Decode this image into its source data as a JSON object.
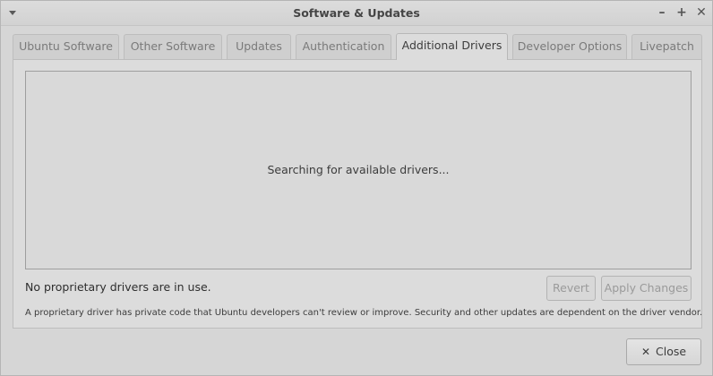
{
  "window": {
    "title": "Software & Updates",
    "controls": {
      "minimize": "–",
      "maximize": "+",
      "close": "✕"
    }
  },
  "tabs": [
    {
      "label": "Ubuntu Software",
      "active": false
    },
    {
      "label": "Other Software",
      "active": false
    },
    {
      "label": "Updates",
      "active": false
    },
    {
      "label": "Authentication",
      "active": false
    },
    {
      "label": "Additional Drivers",
      "active": true
    },
    {
      "label": "Developer Options",
      "active": false
    },
    {
      "label": "Livepatch",
      "active": false
    }
  ],
  "drivers": {
    "searching_text": "Searching for available drivers...",
    "status_text": "No proprietary drivers are in use.",
    "revert_label": "Revert",
    "apply_label": "Apply Changes",
    "note": "A proprietary driver has private code that Ubuntu developers can't review or improve. Security and other updates are dependent on the driver vendor."
  },
  "footer": {
    "close_icon": "✕",
    "close_label": "Close"
  }
}
